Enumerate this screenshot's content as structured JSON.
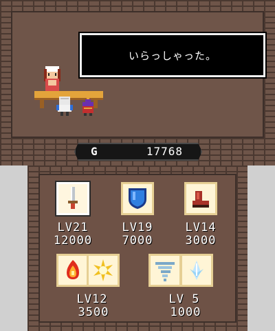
{
  "top_screen": {
    "message": "いらっしゃった。",
    "gold": {
      "label": "G",
      "amount": "17768"
    }
  },
  "upgrades": [
    {
      "name": "sword",
      "level": "LV21",
      "cost": "12000"
    },
    {
      "name": "shield",
      "level": "LV19",
      "cost": "7000"
    },
    {
      "name": "boots",
      "level": "LV14",
      "cost": "3000"
    },
    {
      "name": "fire-light-magic",
      "level": "LV12",
      "cost": "3500"
    },
    {
      "name": "wind-ice-magic",
      "level": "LV 5",
      "cost": "1000"
    }
  ],
  "colors": {
    "brick": "#6f5549",
    "mortar": "#4a3830",
    "slot_bg": "#fff5d6",
    "counter": "#e3a43b"
  }
}
